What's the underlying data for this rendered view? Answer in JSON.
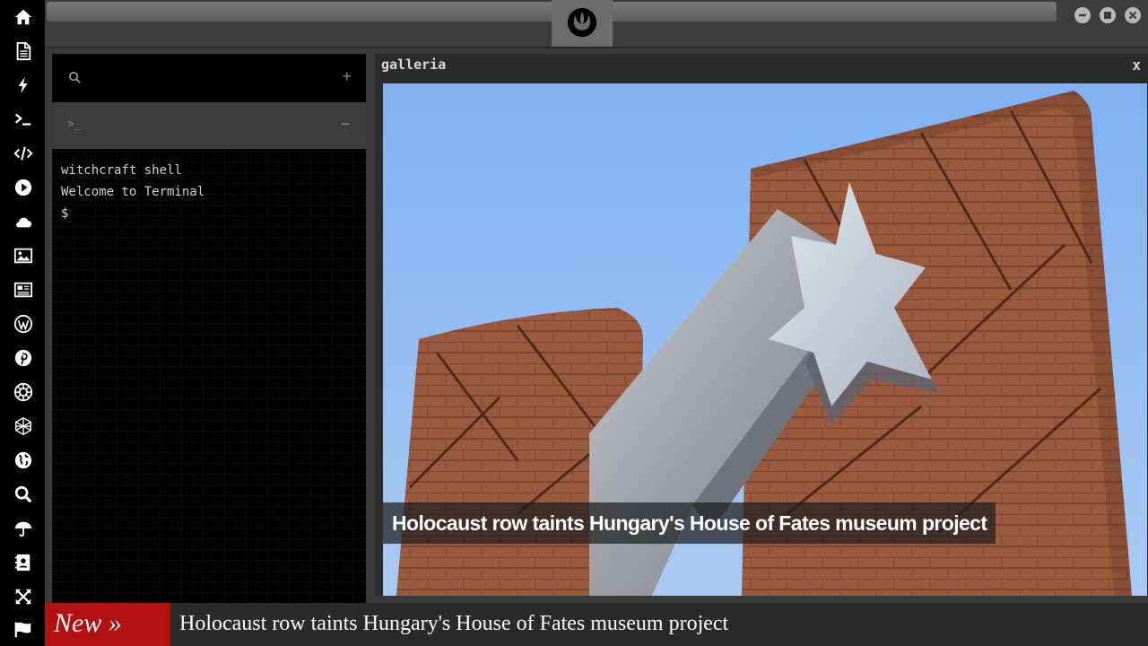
{
  "sidebar": {
    "icons": [
      "home-icon",
      "document-icon",
      "bolt-icon",
      "terminal-icon",
      "code-icon",
      "play-icon",
      "cloud-icon",
      "image-icon",
      "news-icon",
      "wordpress-icon",
      "pinterest-icon",
      "empire-icon",
      "sphere-icon",
      "globe-icon",
      "search-icon",
      "umbrella-icon",
      "contacts-icon",
      "expand-icon",
      "flag-icon"
    ]
  },
  "topbar": {
    "logo": "rebel-alliance-icon",
    "window_buttons": [
      "minimize",
      "maximize",
      "close"
    ]
  },
  "terminal": {
    "search_placeholder": "",
    "add_label": "+",
    "prompt_symbol": ">_",
    "collapse_label": "−",
    "lines": [
      "witchcraft shell",
      "Welcome to Terminal",
      "$"
    ]
  },
  "galleria": {
    "title": "galleria",
    "close_label": "x",
    "caption": "Holocaust row taints Hungary's House of Fates museum project"
  },
  "ticker": {
    "label": "New »",
    "headline": "Holocaust row taints Hungary's House of Fates museum project"
  },
  "colors": {
    "sidebar": "#000000",
    "background": "#3a3a3a",
    "ticker_label": "#b01010",
    "sky": "#8fb8f0",
    "facade": "#9a5a3e"
  }
}
